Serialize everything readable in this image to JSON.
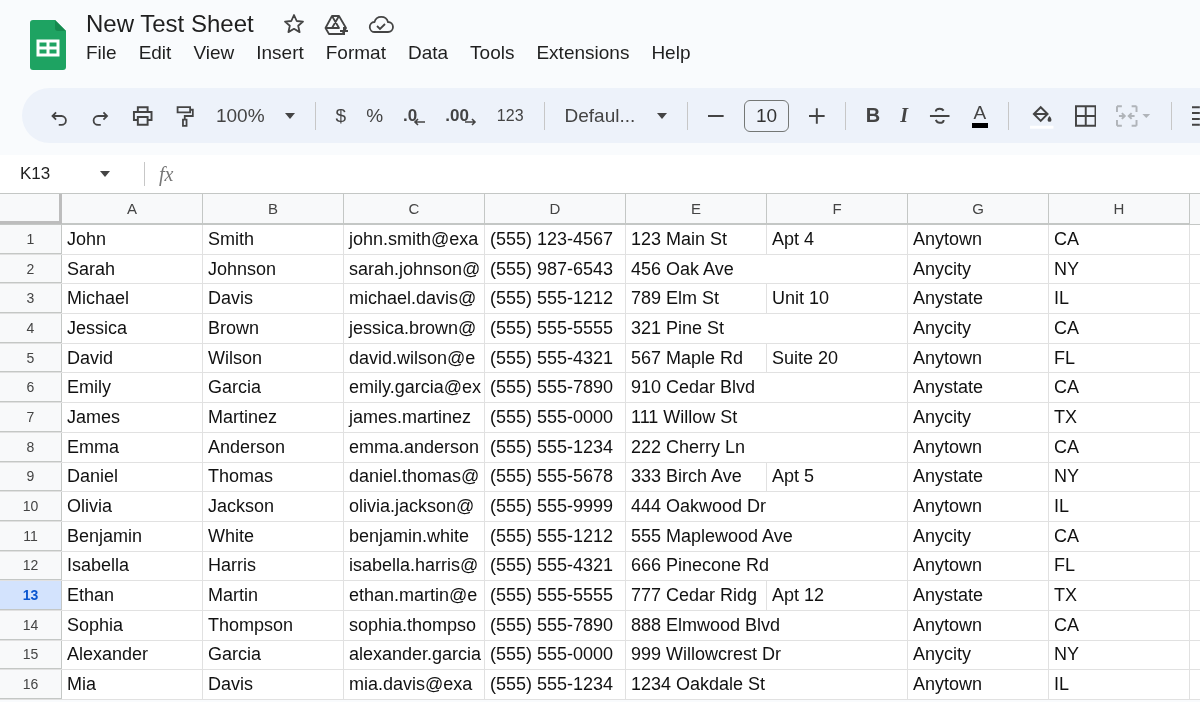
{
  "app": {
    "title": "New Test Sheet"
  },
  "menu": [
    "File",
    "Edit",
    "View",
    "Insert",
    "Format",
    "Data",
    "Tools",
    "Extensions",
    "Help"
  ],
  "toolbar": {
    "zoom": "100%",
    "currency": "$",
    "percent": "%",
    "decrease_decimal": ".0",
    "increase_decimal": ".00",
    "number_format": "123",
    "font": "Defaul...",
    "font_size": "10",
    "bold": "B",
    "italic": "I",
    "text_color": "A",
    "merge_cells": {
      "disabled": true
    }
  },
  "formula_bar": {
    "cell_ref": "K13",
    "fx": "fx"
  },
  "sheet": {
    "columns": [
      "A",
      "B",
      "C",
      "D",
      "E",
      "F",
      "G",
      "H"
    ],
    "rows": [
      {
        "number": "1",
        "selected": false,
        "cells": {
          "A": "John",
          "B": "Smith",
          "C": "john.smith@exa",
          "D": "(555) 123-4567",
          "E": "123 Main St",
          "F": "Apt 4",
          "G": "Anytown",
          "H": "CA"
        }
      },
      {
        "number": "2",
        "selected": false,
        "cells": {
          "A": "Sarah",
          "B": "Johnson",
          "C": "sarah.johnson@",
          "D": "(555) 987-6543",
          "E": "456 Oak Ave",
          "G": "Anycity",
          "H": "NY"
        }
      },
      {
        "number": "3",
        "selected": false,
        "cells": {
          "A": "Michael",
          "B": "Davis",
          "C": "michael.davis@",
          "D": "(555) 555-1212",
          "E": "789 Elm St",
          "F": "Unit 10",
          "G": "Anystate",
          "H": "IL"
        }
      },
      {
        "number": "4",
        "selected": false,
        "cells": {
          "A": "Jessica",
          "B": "Brown",
          "C": "jessica.brown@",
          "D": "(555) 555-5555",
          "E": "321 Pine St",
          "G": "Anycity",
          "H": "CA"
        }
      },
      {
        "number": "5",
        "selected": false,
        "cells": {
          "A": "David",
          "B": "Wilson",
          "C": "david.wilson@e",
          "D": "(555) 555-4321",
          "E": "567 Maple Rd",
          "F": "Suite 20",
          "G": "Anytown",
          "H": "FL"
        }
      },
      {
        "number": "6",
        "selected": false,
        "cells": {
          "A": "Emily",
          "B": "Garcia",
          "C": "emily.garcia@ex",
          "D": "(555) 555-7890",
          "E": "910 Cedar Blvd",
          "G": "Anystate",
          "H": "CA"
        }
      },
      {
        "number": "7",
        "selected": false,
        "cells": {
          "A": "James",
          "B": "Martinez",
          "C": "james.martinez",
          "D": "(555) 555-0000",
          "E": "111 Willow St",
          "G": "Anycity",
          "H": "TX"
        }
      },
      {
        "number": "8",
        "selected": false,
        "cells": {
          "A": "Emma",
          "B": "Anderson",
          "C": "emma.anderson",
          "D": "(555) 555-1234",
          "E": "222 Cherry Ln",
          "G": "Anytown",
          "H": "CA"
        }
      },
      {
        "number": "9",
        "selected": false,
        "cells": {
          "A": "Daniel",
          "B": "Thomas",
          "C": "daniel.thomas@",
          "D": "(555) 555-5678",
          "E": "333 Birch Ave",
          "F": "Apt 5",
          "G": "Anystate",
          "H": "NY"
        }
      },
      {
        "number": "10",
        "selected": false,
        "cells": {
          "A": "Olivia",
          "B": "Jackson",
          "C": "olivia.jackson@",
          "D": "(555) 555-9999",
          "E": "444 Oakwood Dr",
          "G": "Anytown",
          "H": "IL"
        }
      },
      {
        "number": "11",
        "selected": false,
        "cells": {
          "A": "Benjamin",
          "B": "White",
          "C": "benjamin.white",
          "D": "(555) 555-1212",
          "E": "555 Maplewood Ave",
          "G": "Anycity",
          "H": "CA"
        }
      },
      {
        "number": "12",
        "selected": false,
        "cells": {
          "A": "Isabella",
          "B": "Harris",
          "C": "isabella.harris@",
          "D": "(555) 555-4321",
          "E": "666 Pinecone Rd",
          "G": "Anytown",
          "H": "FL"
        }
      },
      {
        "number": "13",
        "selected": true,
        "cells": {
          "A": "Ethan",
          "B": "Martin",
          "C": "ethan.martin@e",
          "D": "(555) 555-5555",
          "E": "777 Cedar Ridg",
          "F": "Apt 12",
          "G": "Anystate",
          "H": "TX"
        }
      },
      {
        "number": "14",
        "selected": false,
        "cells": {
          "A": "Sophia",
          "B": "Thompson",
          "C": "sophia.thompso",
          "D": "(555) 555-7890",
          "E": "888 Elmwood Blvd",
          "G": "Anytown",
          "H": "CA"
        }
      },
      {
        "number": "15",
        "selected": false,
        "cells": {
          "A": "Alexander",
          "B": "Garcia",
          "C": "alexander.garcia",
          "D": "(555) 555-0000",
          "E": "999 Willowcrest Dr",
          "G": "Anycity",
          "H": "NY"
        }
      },
      {
        "number": "16",
        "selected": false,
        "cells": {
          "A": "Mia",
          "B": "Davis",
          "C": "mia.davis@exa",
          "D": "(555) 555-1234",
          "E": "1234 Oakdale St",
          "G": "Anytown",
          "H": "IL"
        }
      }
    ]
  }
}
